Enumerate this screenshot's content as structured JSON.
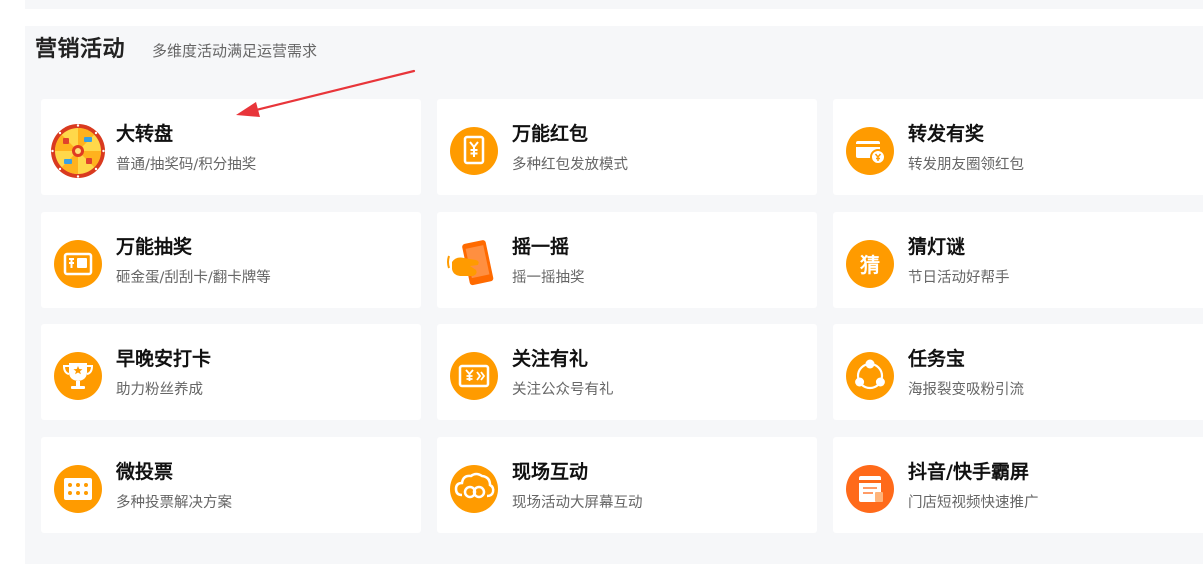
{
  "section": {
    "title": "营销活动",
    "subtitle": "多维度活动满足运营需求"
  },
  "colors": {
    "accent": "#ff9b00",
    "panel_bg": "#f6f7f9",
    "annotation_arrow": "#e8353a"
  },
  "activities": [
    {
      "title": "大转盘",
      "desc": "普通/抽奖码/积分抽奖",
      "icon": "prize-wheel-icon"
    },
    {
      "title": "万能红包",
      "desc": "多种红包发放模式",
      "icon": "red-envelope-icon"
    },
    {
      "title": "转发有奖",
      "desc": "转发朋友圈领红包",
      "icon": "share-reward-icon"
    },
    {
      "title": "万能抽奖",
      "desc": "砸金蛋/刮刮卡/翻卡牌等",
      "icon": "scratch-card-icon"
    },
    {
      "title": "摇一摇",
      "desc": "摇一摇抽奖",
      "icon": "phone-shake-icon"
    },
    {
      "title": "猜灯谜",
      "desc": "节日活动好帮手",
      "icon": "riddle-icon",
      "glyph": "猜"
    },
    {
      "title": "早晚安打卡",
      "desc": "助力粉丝养成",
      "icon": "trophy-icon"
    },
    {
      "title": "关注有礼",
      "desc": "关注公众号有礼",
      "icon": "follow-gift-icon"
    },
    {
      "title": "任务宝",
      "desc": "海报裂变吸粉引流",
      "icon": "task-network-icon"
    },
    {
      "title": "微投票",
      "desc": "多种投票解决方案",
      "icon": "vote-icon"
    },
    {
      "title": "现场互动",
      "desc": "现场活动大屏幕互动",
      "icon": "live-interaction-icon"
    },
    {
      "title": "抖音/快手霸屏",
      "desc": "门店短视频快速推广",
      "icon": "short-video-icon"
    }
  ]
}
